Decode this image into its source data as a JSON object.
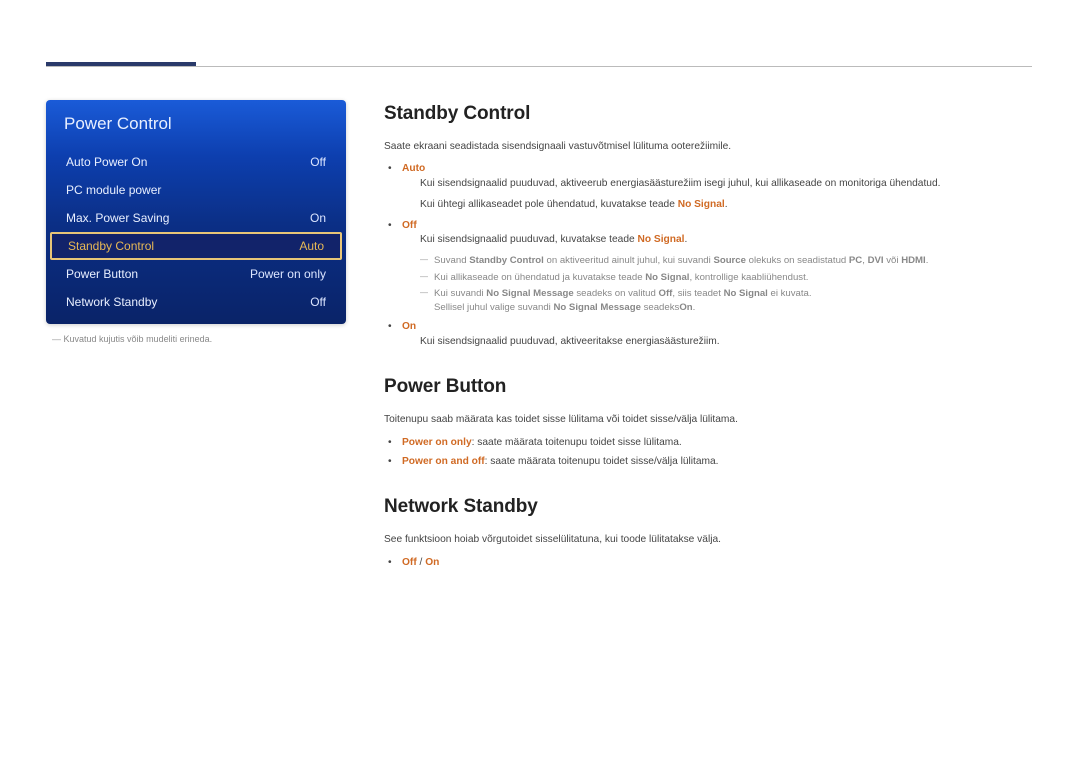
{
  "menu": {
    "title": "Power Control",
    "items": [
      {
        "label": "Auto Power On",
        "value": "Off",
        "highlight": false
      },
      {
        "label": "PC module power",
        "value": "",
        "highlight": false
      },
      {
        "label": "Max. Power Saving",
        "value": "On",
        "highlight": false
      },
      {
        "label": "Standby Control",
        "value": "Auto",
        "highlight": true
      },
      {
        "label": "Power Button",
        "value": "Power on only",
        "highlight": false
      },
      {
        "label": "Network Standby",
        "value": "Off",
        "highlight": false
      }
    ]
  },
  "caption_dash": "―",
  "caption": "Kuvatud kujutis võib mudeliti erineda.",
  "sections": {
    "standby": {
      "heading": "Standby Control",
      "intro": "Saate ekraani seadistada sisendsignaali vastuvõtmisel lülituma ooterežiimile.",
      "auto_label": "Auto",
      "auto_l1": "Kui sisendsignaalid puuduvad, aktiveerub energiasäästurežiim isegi juhul, kui allikaseade on monitoriga ühendatud.",
      "auto_l2a": "Kui ühtegi allikaseadet pole ühendatud, kuvatakse teade ",
      "auto_l2b": "No Signal",
      "auto_l2c": ".",
      "off_label": "Off",
      "off_l1a": "Kui sisendsignaalid puuduvad, kuvatakse teade ",
      "off_l1b": "No Signal",
      "off_l1c": ".",
      "d1_a": "Suvand ",
      "d1_b": "Standby Control",
      "d1_c": " on aktiveeritud ainult juhul, kui suvandi ",
      "d1_d": "Source",
      "d1_e": " olekuks on seadistatud ",
      "d1_f": "PC",
      "d1_g": ", ",
      "d1_h": "DVI",
      "d1_i": " või ",
      "d1_j": "HDMI",
      "d1_k": ".",
      "d2_a": "Kui allikaseade on ühendatud ja kuvatakse teade ",
      "d2_b": "No Signal",
      "d2_c": ", kontrollige kaabliühendust.",
      "d3_a": "Kui suvandi ",
      "d3_b": "No Signal Message",
      "d3_c": " seadeks on valitud ",
      "d3_d": "Off",
      "d3_e": ", siis teadet ",
      "d3_f": "No Signal",
      "d3_g": " ei kuvata.",
      "d3_line2_a": "Sellisel juhul valige suvandi ",
      "d3_line2_b": "No Signal Message",
      "d3_line2_c": " seadeks",
      "d3_line2_d": "On",
      "d3_line2_e": ".",
      "on_label": "On",
      "on_l1": "Kui sisendsignaalid puuduvad, aktiveeritakse energiasäästurežiim."
    },
    "powerbtn": {
      "heading": "Power Button",
      "intro": "Toitenupu saab määrata kas toidet sisse lülitama või toidet sisse/välja lülitama.",
      "b1_a": "Power on only",
      "b1_b": ": saate määrata toitenupu toidet sisse lülitama.",
      "b2_a": "Power on and off",
      "b2_b": ": saate määrata toitenupu toidet sisse/välja lülitama."
    },
    "netstandby": {
      "heading": "Network Standby",
      "intro": "See funktsioon hoiab võrgutoidet sisselülitatuna, kui toode lülitatakse välja.",
      "b1_a": "Off",
      "b1_sep": " / ",
      "b1_b": "On"
    }
  }
}
